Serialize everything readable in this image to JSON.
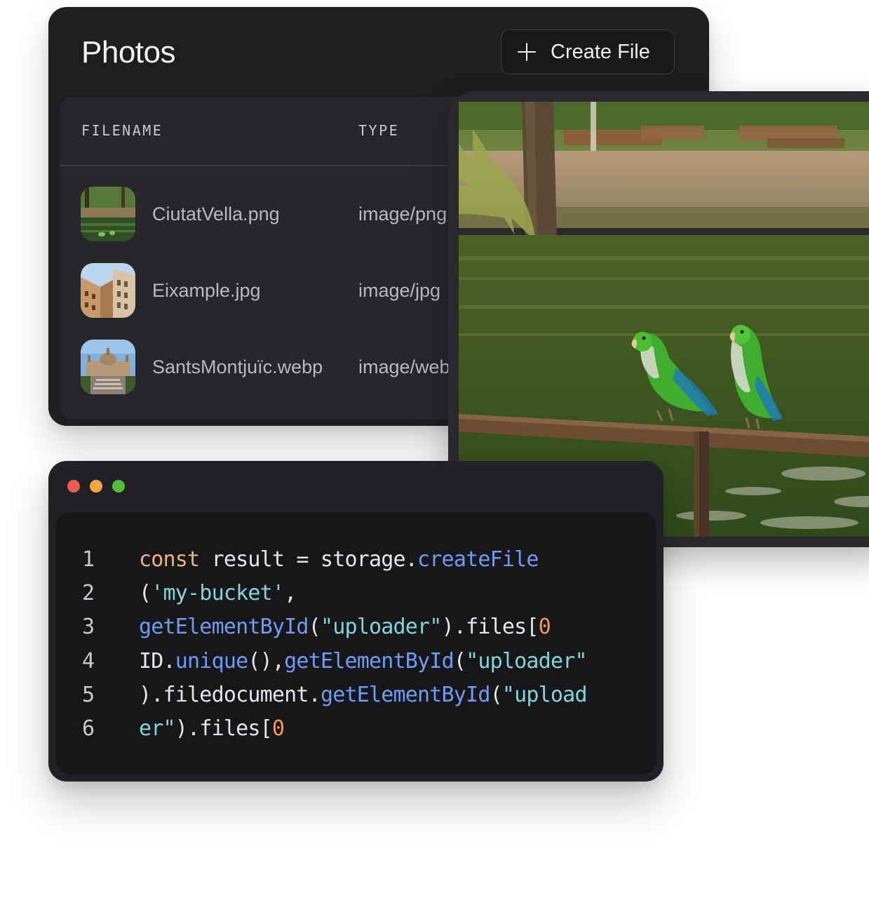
{
  "photos": {
    "title": "Photos",
    "create_button": {
      "label": "Create File",
      "icon": "plus-icon"
    },
    "table": {
      "columns": [
        "FILENAME",
        "TYPE"
      ],
      "rows": [
        {
          "filename": "CiutatVella.png",
          "type": "image/png",
          "thumbnail": "park-pond-thumbnail"
        },
        {
          "filename": "Eixample.jpg",
          "type": "image/jpg",
          "thumbnail": "building-facade-thumbnail"
        },
        {
          "filename": "SantsMontjuïc.webp",
          "type": "image/webp",
          "thumbnail": "palace-thumbnail"
        }
      ]
    }
  },
  "preview": {
    "image": "two-green-parakeets-on-railing-by-pond"
  },
  "code_window": {
    "traffic_lights": {
      "red": "#ec5c50",
      "yellow": "#f2a83d",
      "green": "#52bd3b"
    },
    "syntax_colors": {
      "keyword": "#f4b17a",
      "function": "#6e9cf3",
      "string": "#7fd6d8",
      "number": "#f39a52",
      "plain": "#e6e6ea"
    },
    "lines": [
      {
        "number": "1",
        "tokens": [
          {
            "t": "kw",
            "v": "const"
          },
          {
            "t": "pl",
            "v": " result = storage."
          },
          {
            "t": "fn",
            "v": "createFile"
          }
        ]
      },
      {
        "number": "2",
        "tokens": [
          {
            "t": "pl",
            "v": "("
          },
          {
            "t": "str",
            "v": "'my-bucket'"
          },
          {
            "t": "pl",
            "v": ","
          }
        ]
      },
      {
        "number": "3",
        "tokens": [
          {
            "t": "fn",
            "v": "getElementById"
          },
          {
            "t": "pl",
            "v": "("
          },
          {
            "t": "str",
            "v": "\"uploader\""
          },
          {
            "t": "pl",
            "v": ").files["
          },
          {
            "t": "num",
            "v": "0"
          }
        ]
      },
      {
        "number": "4",
        "tokens": [
          {
            "t": "pl",
            "v": "ID."
          },
          {
            "t": "fn",
            "v": "unique"
          },
          {
            "t": "pl",
            "v": "(),"
          },
          {
            "t": "fn",
            "v": "getElementById"
          },
          {
            "t": "pl",
            "v": "("
          },
          {
            "t": "str",
            "v": "\"uploader\""
          }
        ]
      },
      {
        "number": "5",
        "tokens": [
          {
            "t": "pl",
            "v": ").filedocument."
          },
          {
            "t": "fn",
            "v": "getElementById"
          },
          {
            "t": "pl",
            "v": "("
          },
          {
            "t": "str",
            "v": "\"upload"
          }
        ]
      },
      {
        "number": "6",
        "tokens": [
          {
            "t": "str",
            "v": "er\""
          },
          {
            "t": "pl",
            "v": ").files["
          },
          {
            "t": "num",
            "v": "0"
          }
        ]
      }
    ]
  }
}
